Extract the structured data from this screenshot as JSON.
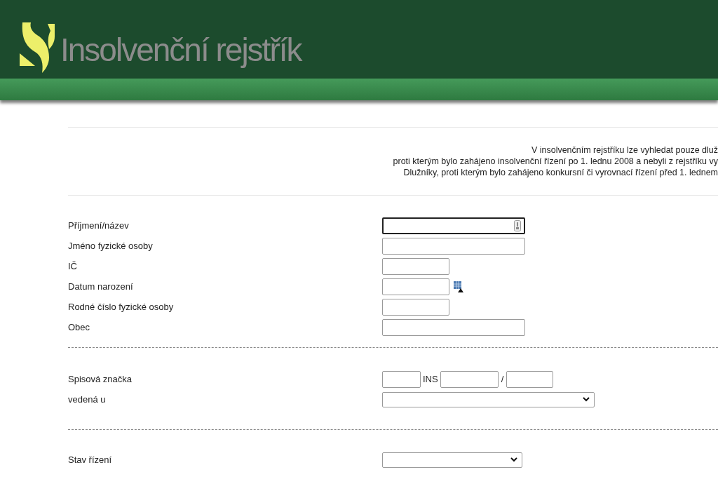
{
  "header": {
    "title": "Insolvenční rejstřík"
  },
  "notice": [
    "V insolvenčním rejstříku lze vyhledat pouze dluž",
    "proti kterým bylo zahájeno insolvenční řízení po 1. lednu 2008 a nebyli z rejstříku vy",
    "Dlužníky, proti kterým bylo zahájeno konkursní či vyrovnací řízení před 1. lednem"
  ],
  "person_fields": [
    {
      "label": "Příjmení/název",
      "kind": "wide",
      "focused": true
    },
    {
      "label": "Jméno fyzické osoby",
      "kind": "wide",
      "focused": false
    },
    {
      "label": "IČ",
      "kind": "short",
      "focused": false
    },
    {
      "label": "Datum narození",
      "kind": "date",
      "focused": false
    },
    {
      "label": "Rodné číslo fyzické osoby",
      "kind": "short",
      "focused": false
    },
    {
      "label": "Obec",
      "kind": "wide",
      "focused": false
    }
  ],
  "case_number": {
    "label": "Spisová značka",
    "prefix": "INS",
    "separator": "/"
  },
  "court": {
    "label": "vedená u"
  },
  "status": {
    "label": "Stav řízení"
  }
}
